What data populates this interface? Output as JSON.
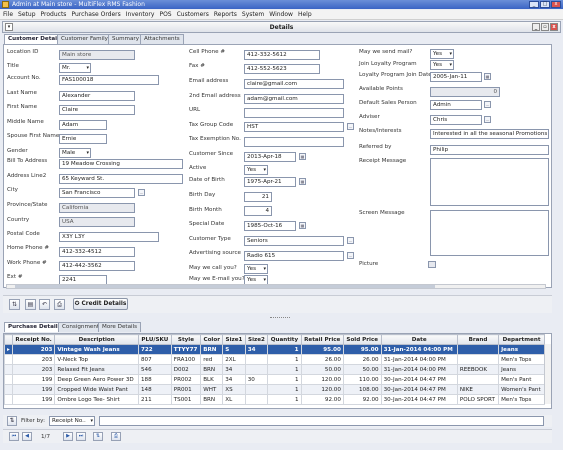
{
  "window": {
    "title": "Admin at Main store - MultiFlex RMS Fashion"
  },
  "menu": [
    "File",
    "Setup",
    "Products",
    "Purchase Orders",
    "Inventory",
    "POS",
    "Customers",
    "Reports",
    "System",
    "Window",
    "Help"
  ],
  "details_title": "Details",
  "tabs": [
    "Customer Details",
    "Customer Family",
    "Summary",
    "Attachments"
  ],
  "col1": {
    "location_id": {
      "label": "Location ID",
      "value": "Main store"
    },
    "title": {
      "label": "Title",
      "value": "Mr."
    },
    "account_no": {
      "label": "Account No.",
      "value": "FAS100018"
    },
    "last_name": {
      "label": "Last Name",
      "value": "Alexander"
    },
    "first_name": {
      "label": "First Name",
      "value": "Claire"
    },
    "middle_name": {
      "label": "Middle Name",
      "value": "Adam"
    },
    "spouse_first_name": {
      "label": "Spouse First Name",
      "value": "Ernie"
    },
    "gender": {
      "label": "Gender",
      "value": "Male"
    },
    "bill_to_address": {
      "label": "Bill To Address",
      "value": "19 Meadow Crossing"
    },
    "address_line2": {
      "label": "Address Line2",
      "value": "65 Keyward St."
    },
    "city": {
      "label": "City",
      "value": "San Francisco"
    },
    "province": {
      "label": "Province/State",
      "value": "California"
    },
    "country": {
      "label": "Country",
      "value": "USA"
    },
    "postal_code": {
      "label": "Postal Code",
      "value": "X3Y L3Y"
    },
    "home_phone": {
      "label": "Home Phone #",
      "value": "412-332-4512"
    },
    "work_phone": {
      "label": "Work Phone #",
      "value": "412-442-3562"
    },
    "ext": {
      "label": "Ext #",
      "value": "2241"
    }
  },
  "col2": {
    "cell_phone": {
      "label": "Cell Phone #",
      "value": "412-332-5612"
    },
    "fax": {
      "label": "Fax #",
      "value": "412-552-5623"
    },
    "email": {
      "label": "Email address",
      "value": "claire@gmail.com"
    },
    "email2": {
      "label": "2nd Email address",
      "value": "adam@gmail.com"
    },
    "url": {
      "label": "URL",
      "value": ""
    },
    "tax_group": {
      "label": "Tax Group Code",
      "value": "HST"
    },
    "tax_exemption": {
      "label": "Tax Exemption No.",
      "value": ""
    },
    "customer_since": {
      "label": "Customer Since",
      "value": "2013-Apr-18"
    },
    "active": {
      "label": "Active",
      "value": "Yes"
    },
    "dob": {
      "label": "Date of Birth",
      "value": "1975-Apr-21"
    },
    "birth_day": {
      "label": "Birth Day",
      "value": "21"
    },
    "birth_month": {
      "label": "Birth Month",
      "value": "4"
    },
    "special_date": {
      "label": "Special Date",
      "value": "1985-Oct-16"
    },
    "customer_type": {
      "label": "Customer Type",
      "value": "Seniors"
    },
    "advertising": {
      "label": "Advertising source",
      "value": "Radio 615"
    },
    "may_call": {
      "label": "May we call you?",
      "value": "Yes"
    },
    "may_email": {
      "label": "May we E-mail you?",
      "value": "Yes"
    }
  },
  "col3": {
    "may_send_mail": {
      "label": "May we send mail?",
      "value": "Yes"
    },
    "join_loyalty": {
      "label": "Join Loyalty Program",
      "value": "Yes"
    },
    "loyalty_join_date": {
      "label": "Loyalty Program Join Date",
      "value": "2005-Jan-11"
    },
    "available_points": {
      "label": "Available Points",
      "value": "0"
    },
    "default_sales_person": {
      "label": "Default Sales Person",
      "value": "Admin"
    },
    "adviser": {
      "label": "Adviser",
      "value": "Chris"
    },
    "notes": {
      "label": "Notes/Interests",
      "value": "Interested in all the seasonal Promotions!!"
    },
    "referred_by": {
      "label": "Referred by",
      "value": "Philip"
    },
    "receipt_message": {
      "label": "Receipt Message",
      "value": ""
    },
    "screen_message": {
      "label": "Screen Message",
      "value": ""
    },
    "picture": {
      "label": "Picture"
    }
  },
  "toolbar": {
    "credit_details": "Credit Details"
  },
  "bottom_tabs": [
    "Purchase Details",
    "Consignment",
    "More Details"
  ],
  "grid": {
    "columns": [
      "Receipt No.",
      "Description",
      "PLU/SKU",
      "Style",
      "Color",
      "Size1",
      "Size2",
      "Quantity",
      "Retail Price",
      "Sold Price",
      "Date",
      "Brand",
      "Department"
    ],
    "rows": [
      [
        "203",
        "Vintage Wash Jeans",
        "722",
        "TTYY77",
        "BRN",
        "S",
        "34",
        "1",
        "95.00",
        "95.00",
        "31-Jan-2014 04:00 PM",
        "",
        "Jeans"
      ],
      [
        "203",
        "V-Neck Top",
        "807",
        "FRA100",
        "red",
        "2XL",
        "",
        "1",
        "26.00",
        "26.00",
        "31-Jan-2014 04:00 PM",
        "",
        "Men's Tops"
      ],
      [
        "203",
        "Relaxed Fit Jeans",
        "546",
        "D002",
        "BRN",
        "34",
        "",
        "1",
        "50.00",
        "50.00",
        "31-Jan-2014 04:00 PM",
        "REEBOOK",
        "Jeans"
      ],
      [
        "199",
        "Deep Green Aero Power 3D",
        "188",
        "PR002",
        "BLK",
        "34",
        "30",
        "1",
        "120.00",
        "110.00",
        "30-Jan-2014 04:47 PM",
        "",
        "Men's Pant"
      ],
      [
        "199",
        "Cropped Wide Waist Pant",
        "148",
        "PR001",
        "WHT",
        "XS",
        "",
        "1",
        "120.00",
        "108.00",
        "30-Jan-2014 04:47 PM",
        "NIKE",
        "Women's Pant"
      ],
      [
        "199",
        "Ombre Logo Tee- Shirt",
        "211",
        "TS001",
        "BRN",
        "XL",
        "",
        "1",
        "92.00",
        "92.00",
        "30-Jan-2014 04:47 PM",
        "POLO SPORT",
        "Men's Tops"
      ]
    ]
  },
  "filter": {
    "label": "Filter by:",
    "value": "Receipt No.."
  },
  "nav": {
    "page": "1/7"
  },
  "colors": {
    "selected_row": "#2e5ea9",
    "title_bar": "#3a64c4"
  }
}
